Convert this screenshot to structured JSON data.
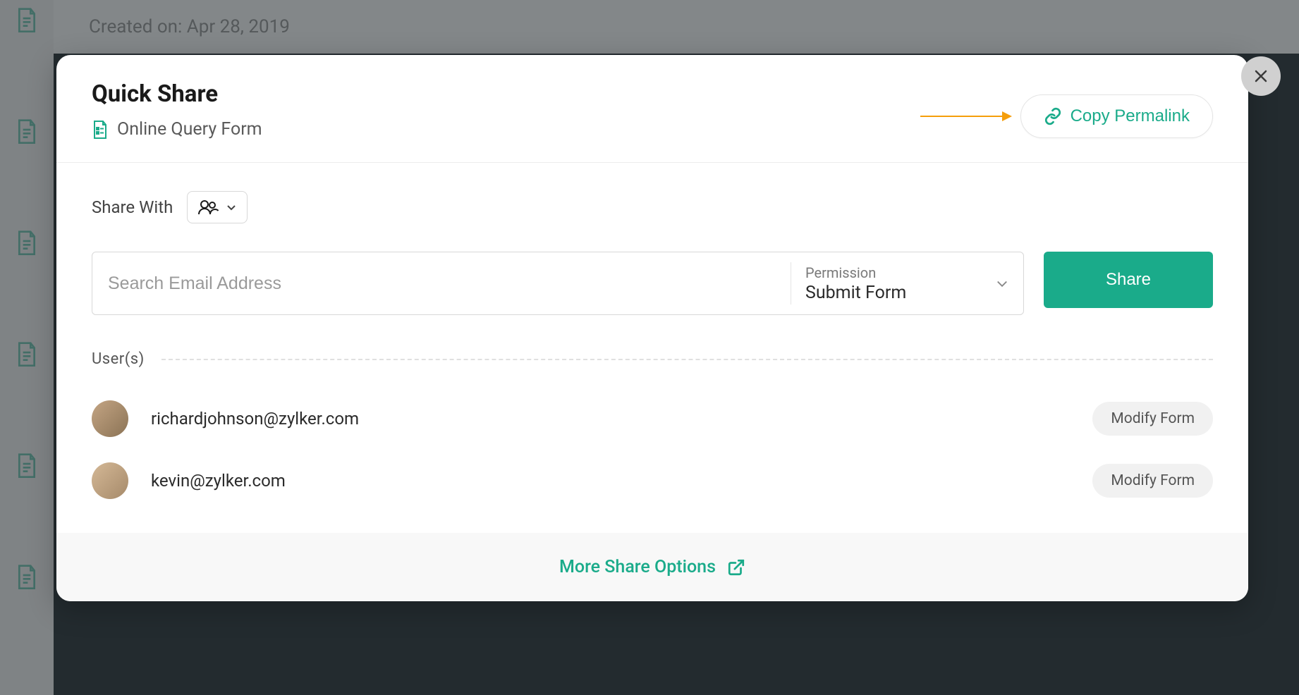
{
  "background": {
    "created_label": "Created on: Apr 28, 2019"
  },
  "modal": {
    "title": "Quick Share",
    "form_name": "Online Query Form",
    "copy_permalink_label": "Copy Permalink",
    "share_with_label": "Share With",
    "email_placeholder": "Search Email Address",
    "permission": {
      "label": "Permission",
      "value": "Submit Form"
    },
    "share_button_label": "Share",
    "users_heading": "User(s)",
    "users": [
      {
        "email": "richardjohnson@zylker.com",
        "permission": "Modify Form"
      },
      {
        "email": "kevin@zylker.com",
        "permission": "Modify Form"
      }
    ],
    "more_options_label": "More Share Options"
  }
}
